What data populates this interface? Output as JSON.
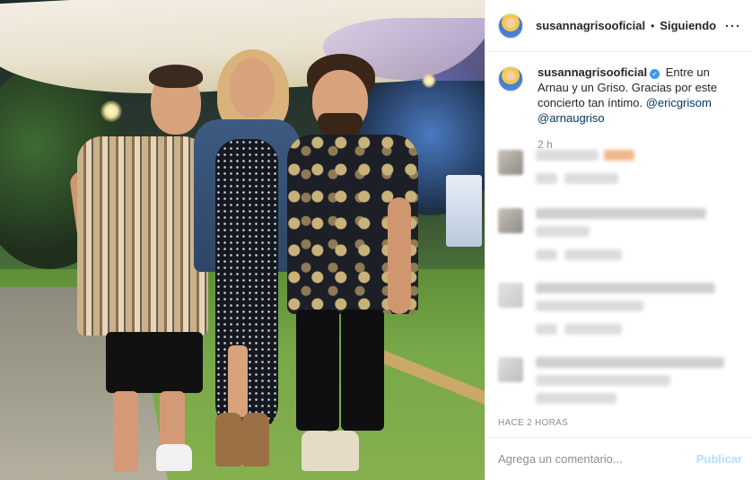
{
  "post": {
    "username": "susannagrisooficial",
    "follow_separator": "•",
    "follow_status": "Siguiendo",
    "more_icon": "more-horizontal-icon",
    "caption": {
      "username": "susannagrisooficial",
      "text": "Entre un Arnau y un Griso. Gracias por este concierto tan íntimo.",
      "mentions": [
        "@ericgrisom",
        "@arnaugriso"
      ]
    },
    "time_ago": "2 h",
    "date_label": "HACE 2 HORAS"
  },
  "comment_box": {
    "placeholder": "Agrega un comentario...",
    "publish_label": "Publicar"
  },
  "colors": {
    "link": "#00376b",
    "publish_disabled": "#b2dffc",
    "verified": "#3897f0",
    "muted": "#8e8e8e"
  }
}
